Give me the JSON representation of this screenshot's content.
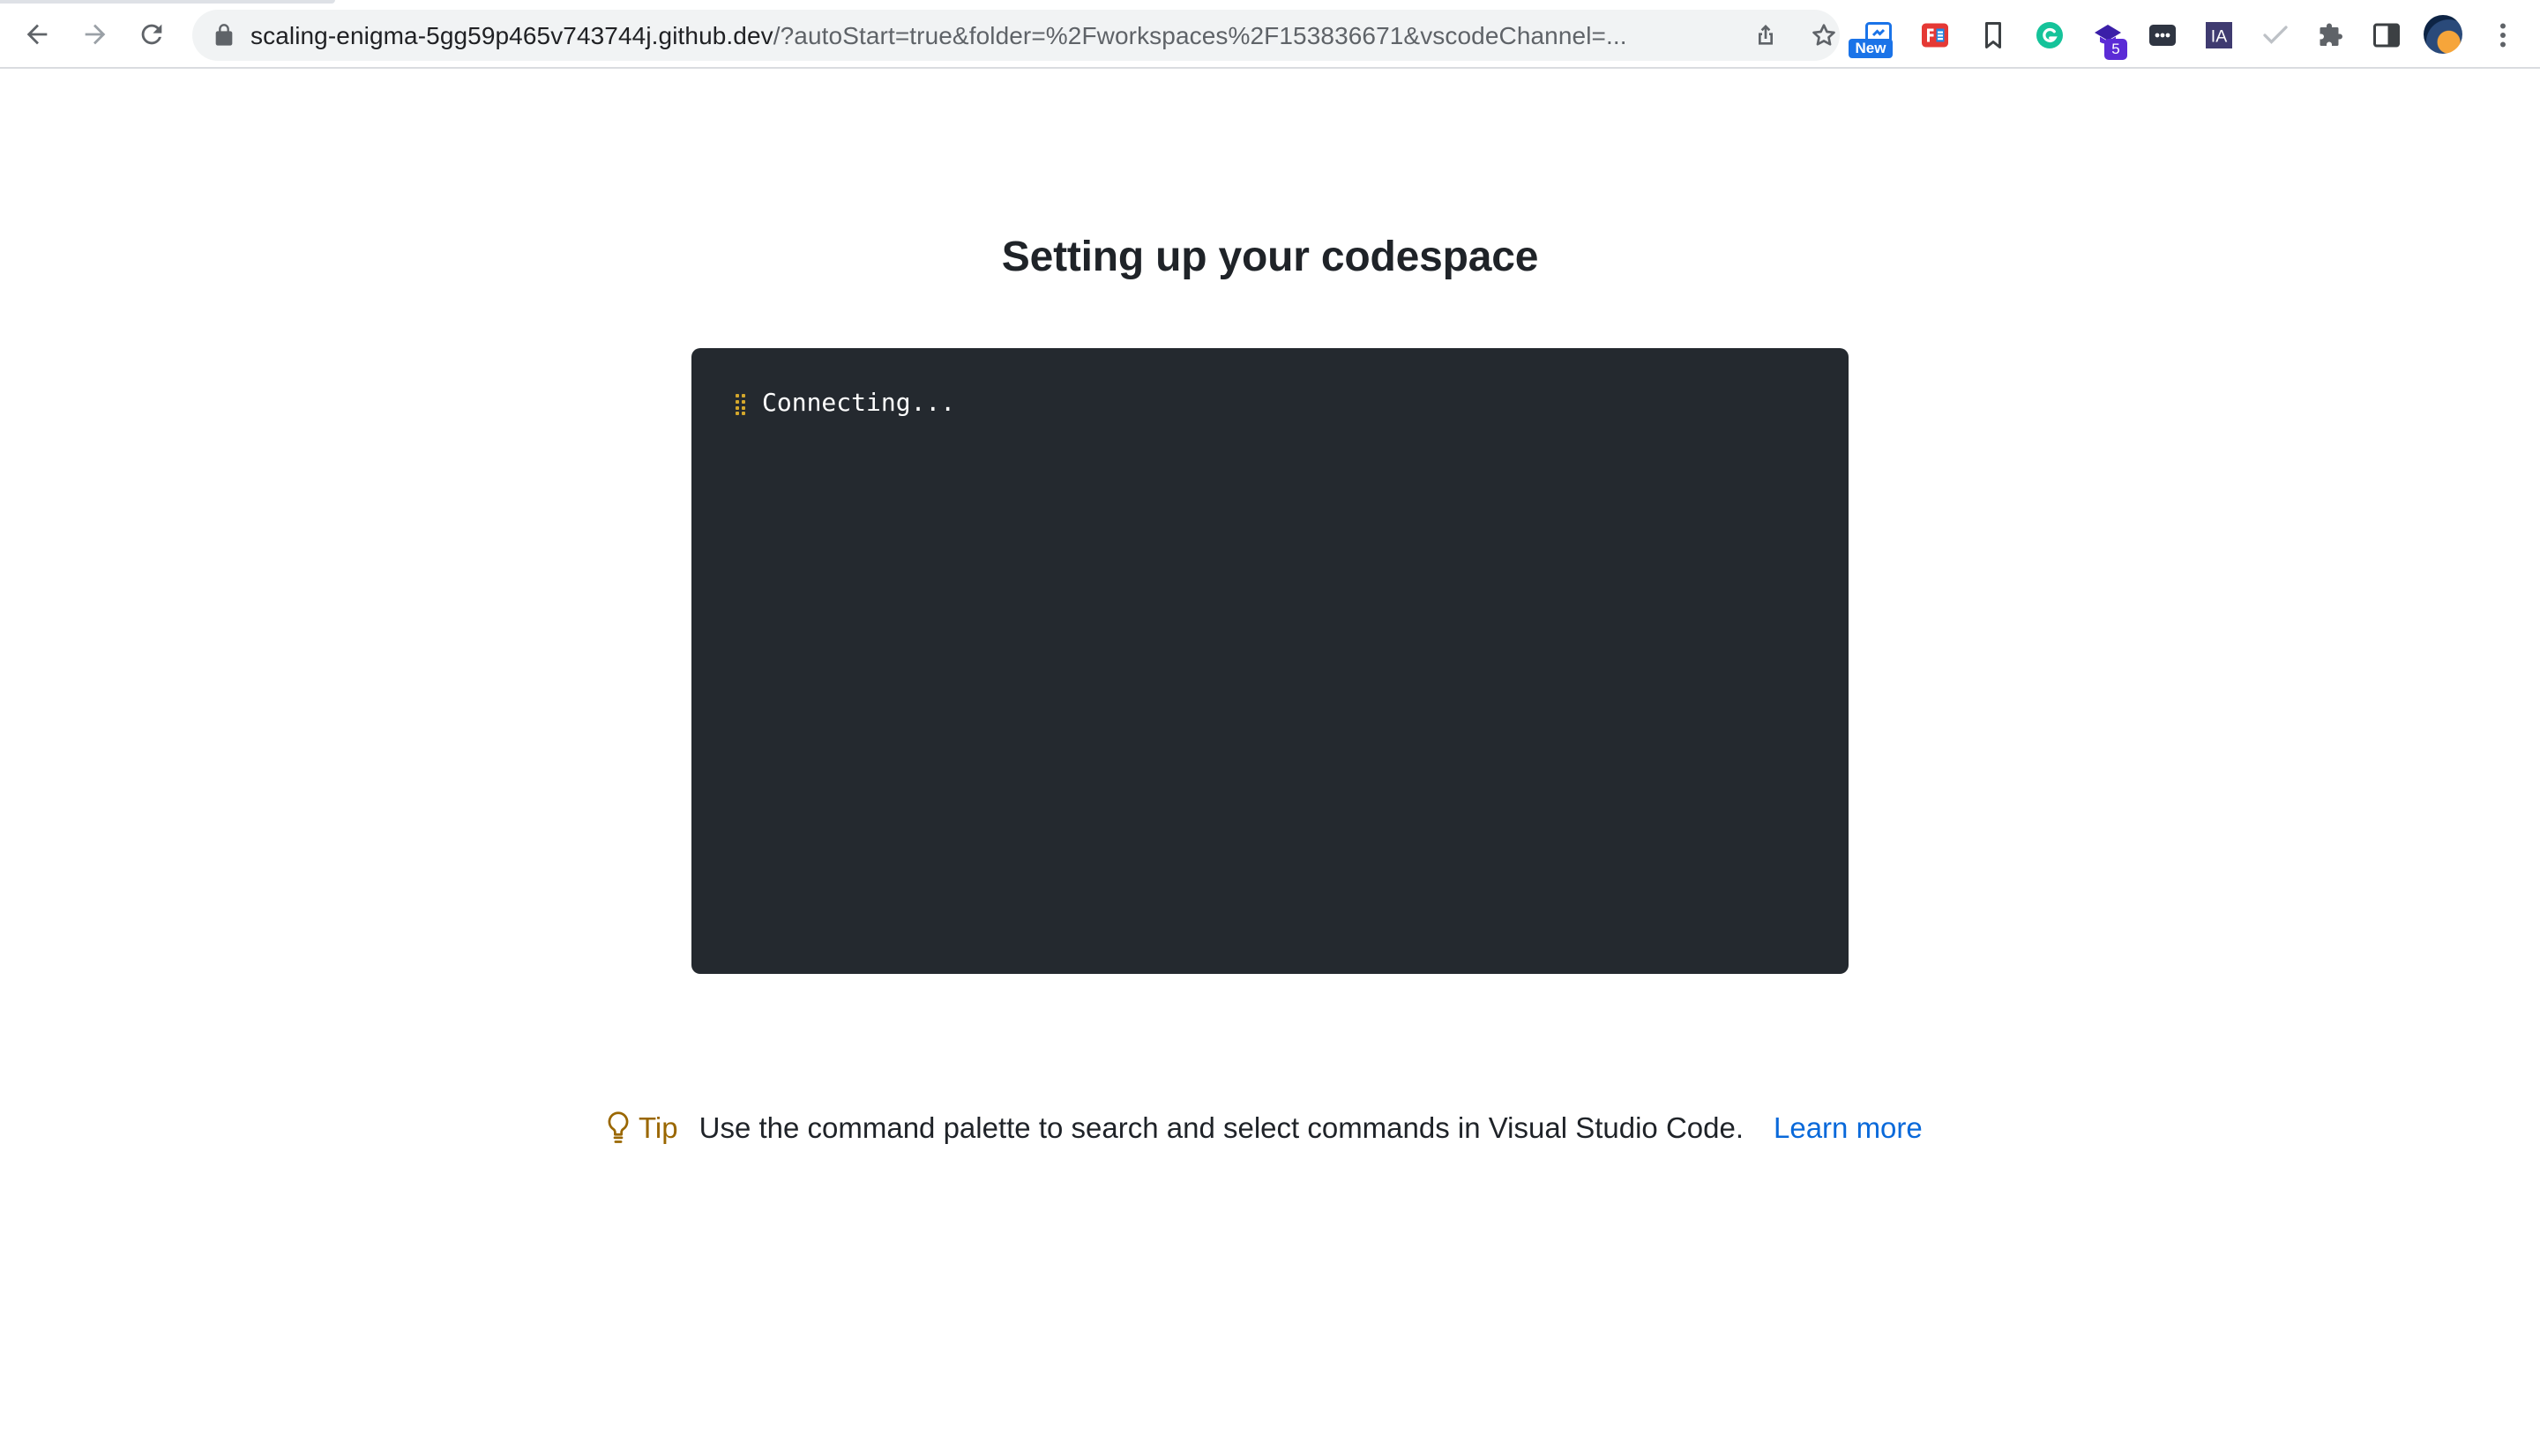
{
  "browser": {
    "url_host": "scaling-enigma-5gg59p465v743744j.github.dev",
    "url_rest": "/?autoStart=true&folder=%2Fworkspaces%2F153836671&vscodeChannel=...",
    "extensions": {
      "new_badge": "New",
      "count_badge": "5",
      "ia_label": "IA"
    }
  },
  "page": {
    "title": "Setting up your codespace"
  },
  "terminal": {
    "status_line": "Connecting..."
  },
  "tip": {
    "label": "Tip",
    "text": "Use the command palette to search and select commands in Visual Studio Code.",
    "link_label": "Learn more"
  },
  "colors": {
    "terminal_bg": "#24292f",
    "tip_accent": "#9a6700",
    "link": "#0969da",
    "spinner": "#d4a72c"
  }
}
